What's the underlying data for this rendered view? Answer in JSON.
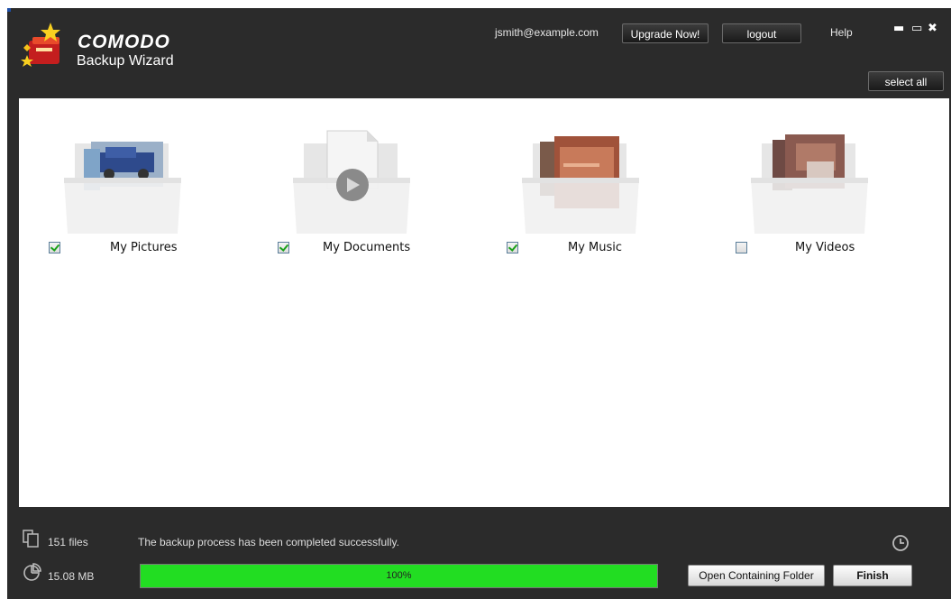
{
  "header": {
    "brand": "COMODO",
    "subtitle": "Backup Wizard",
    "user_email": "jsmith@example.com",
    "upgrade_label": "Upgrade Now!",
    "logout_label": "logout",
    "help_label": "Help",
    "minimize_glyph": "▬",
    "restore_glyph": "▭",
    "close_glyph": "✖",
    "select_all_label": "select all"
  },
  "folders": [
    {
      "label": "My Pictures",
      "checked": true,
      "icon": "pictures-folder-icon"
    },
    {
      "label": "My Documents",
      "checked": true,
      "icon": "documents-folder-icon"
    },
    {
      "label": "My Music",
      "checked": true,
      "icon": "music-folder-icon"
    },
    {
      "label": "My Videos",
      "checked": false,
      "icon": "videos-folder-icon"
    }
  ],
  "footer": {
    "files_count": "151 files",
    "status_message": "The backup process has been completed successfully.",
    "total_size": "15.08 MB",
    "progress_percent": 100,
    "progress_label": "100%",
    "open_folder_label": "Open Containing Folder",
    "finish_label": "Finish"
  },
  "colors": {
    "background": "#2b2b2b",
    "progress": "#22dd22",
    "check": "#1aa11a"
  }
}
